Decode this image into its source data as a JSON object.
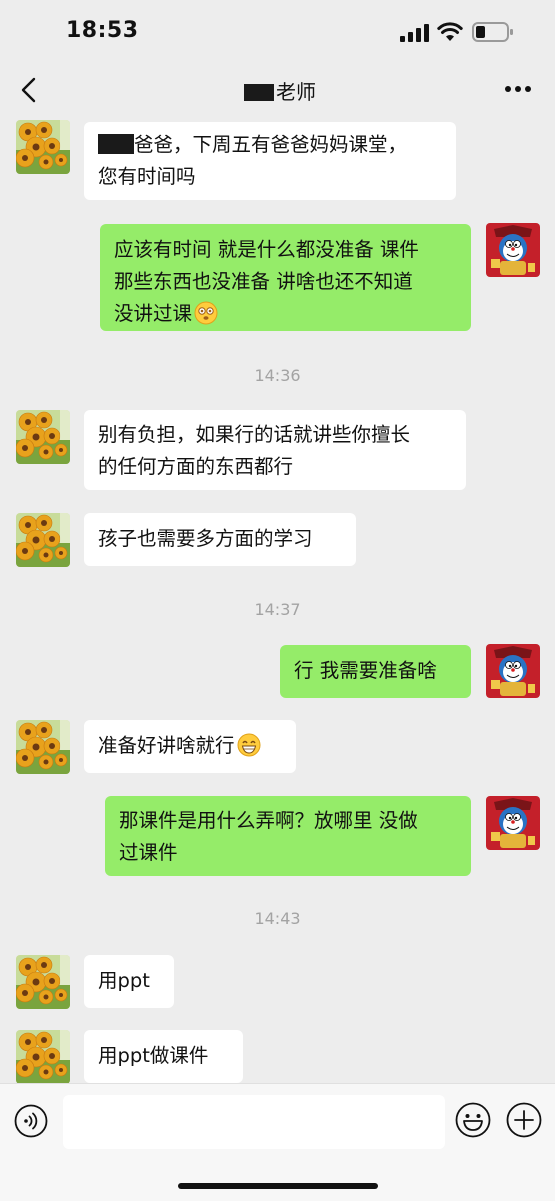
{
  "status_bar": {
    "time": "18:53"
  },
  "chat": {
    "title": "老师",
    "messages": [
      {
        "sender": "contact",
        "lines": [
          "爸爸，下周五有爸爸妈妈课堂，",
          "您有时间吗"
        ]
      },
      {
        "sender": "me",
        "lines": [
          "应该有时间 就是什么都没准备 课件",
          "那些东西也没准备 讲啥也还不知道",
          "没讲过课"
        ],
        "emoji": "dizzy-face"
      },
      {
        "sender": "contact",
        "lines": [
          "别有负担，如果行的话就讲些你擅长",
          "的任何方面的东西都行"
        ]
      },
      {
        "sender": "contact",
        "lines": [
          "孩子也需要多方面的学习"
        ]
      },
      {
        "sender": "me",
        "lines": [
          "行 我需要准备啥"
        ]
      },
      {
        "sender": "contact",
        "lines": [
          "准备好讲啥就行"
        ],
        "emoji": "grinning-face"
      },
      {
        "sender": "me",
        "lines": [
          "那课件是用什么弄啊？放哪里 没做",
          "过课件"
        ]
      },
      {
        "sender": "contact",
        "lines": [
          "用ppt"
        ]
      },
      {
        "sender": "contact",
        "lines": [
          "用ppt做课件"
        ]
      }
    ],
    "timestamps": [
      "14:36",
      "14:37",
      "14:43"
    ]
  },
  "input_bar": {
    "placeholder": ""
  },
  "colors": {
    "background": "#ededed",
    "my_bubble": "#95ec69",
    "their_bubble": "#ffffff",
    "timestamp": "#a3a3a3"
  }
}
